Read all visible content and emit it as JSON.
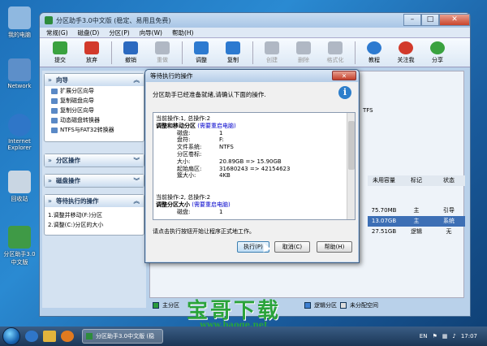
{
  "desktop": {
    "icons": [
      {
        "label": "我的电脑",
        "color": "#8fb8e0"
      },
      {
        "label": "Network",
        "color": "#5d8fc9"
      },
      {
        "label": "Internet Explorer",
        "color": "#2f76c8"
      },
      {
        "label": "回收站",
        "color": "#c9d6e3"
      },
      {
        "label": "分区助手3.0中文版",
        "color": "#3f9a46"
      }
    ]
  },
  "window": {
    "title": "分区助手3.0中文版 (稳定、易用且免费)",
    "menu": [
      "常规(G)",
      "磁盘(D)",
      "分区(P)",
      "向导(W)",
      "帮助(H)"
    ],
    "toolbar": [
      {
        "label": "提交",
        "color": "#3aa23f",
        "disabled": false
      },
      {
        "label": "放弃",
        "color": "#d23a2b",
        "disabled": false
      },
      {
        "label": "撤销",
        "color": "#2c6ac0",
        "disabled": false
      },
      {
        "label": "重做",
        "color": "#b0b8c4",
        "disabled": true
      },
      {
        "label": "调整",
        "color": "#2d7ad0",
        "disabled": false
      },
      {
        "label": "复制",
        "color": "#2d7ad0",
        "disabled": false
      },
      {
        "label": "创建",
        "color": "#b0b8c4",
        "disabled": true
      },
      {
        "label": "删除",
        "color": "#b0b8c4",
        "disabled": true
      },
      {
        "label": "格式化",
        "color": "#b0b8c4",
        "disabled": true
      },
      {
        "label": "教程",
        "color": "#2d7ad0",
        "disabled": false
      },
      {
        "label": "关注我",
        "color": "#d23a2b",
        "disabled": false
      },
      {
        "label": "分享",
        "color": "#3aa23f",
        "disabled": false
      }
    ]
  },
  "sidebar": {
    "wizard_title": "向导",
    "wizard_items": [
      "扩展分区向导",
      "复制磁盘向导",
      "复制分区向导",
      "动态磁盘转换器",
      "NTFS与FAT32转换器"
    ],
    "partition_ops": "分区操作",
    "disk_ops": "磁盘操作",
    "pending_title": "等待执行的操作",
    "pending_items": [
      "1.调整并移动(F:)分区",
      "2.调整(C:)分区的大小"
    ]
  },
  "main": {
    "ntfs": "TFS",
    "headers": [
      "未用容量",
      "标记",
      "状态"
    ],
    "rows": [
      [
        "75.70MB",
        "主",
        "引导"
      ],
      [
        "13.07GB",
        "主",
        "系统"
      ],
      [
        "27.51GB",
        "逻辑",
        "无"
      ]
    ],
    "legend": [
      "主分区",
      "逻辑分区",
      "未分配空间"
    ]
  },
  "dialog": {
    "title": "等待执行的操作",
    "message": "分区助手已经准备就绪,请确认下面的操作.",
    "ops": [
      {
        "header": "当前操作:1, 总操作:2",
        "title": "调整和移动分区",
        "restart": "(需要重启电脑)",
        "fields": [
          [
            "磁盘:",
            "1"
          ],
          [
            "盘符:",
            "F:"
          ],
          [
            "文件系统:",
            "NTFS"
          ],
          [
            "分区卷标:",
            ""
          ],
          [
            "大小:",
            "20.89GB => 15.90GB"
          ],
          [
            "起始扇区:",
            "31680243 => 42154623"
          ],
          [
            "簇大小:",
            "4KB"
          ]
        ]
      },
      {
        "header": "当前操作:2, 总操作:2",
        "title": "调整分区大小",
        "restart": "(需要重启电脑)",
        "fields": [
          [
            "磁盘:",
            "1"
          ]
        ]
      }
    ],
    "footer": "请点击执行按钮开始让程序正式地工作。",
    "btn_execute": "执行(P)",
    "btn_cancel": "取消(C)",
    "btn_help": "帮助(H)"
  },
  "taskbar": {
    "task": "分区助手3.0中文版 (稳定...",
    "lang": "EN",
    "time": "17:07"
  },
  "watermark": {
    "text": "宝哥下载",
    "url": "www.baoge.net"
  }
}
